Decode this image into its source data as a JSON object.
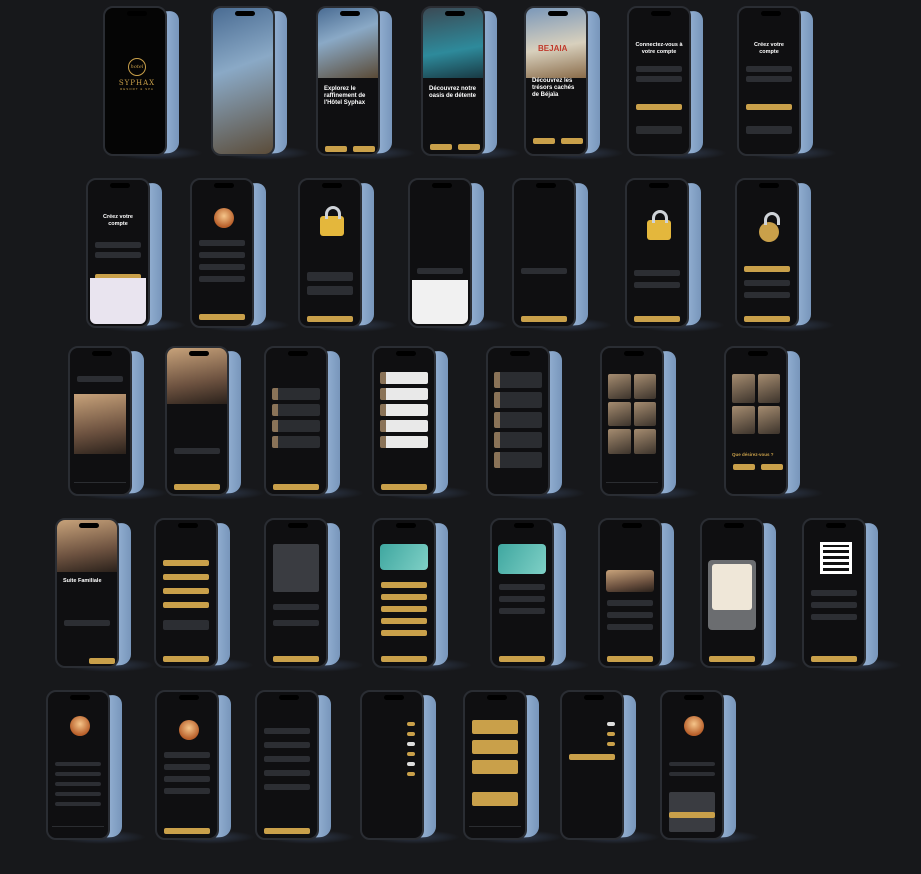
{
  "splash": {
    "logo_script": "hotel",
    "brand_name": "SYPHAX",
    "brand_tagline": "RESORT & SPA"
  },
  "onboarding": {
    "slide1_title": "Explorez le raffinement de l'Hôtel Syphax",
    "slide2_title": "Découvrez notre oasis de détente",
    "slide3_title": "Découvrez les trésors cachés de Béjaïa",
    "slide3_sign": "BEJAIA"
  },
  "auth": {
    "login_title": "Connectez-vous à votre compte",
    "signup_title": "Créez votre compte",
    "signup_title_2": "Créez votre compte"
  },
  "home": {
    "top_room_name": "Suite Familiale",
    "question": "Que désirez-vous ?"
  },
  "colors": {
    "background": "#17181b",
    "accent_gold": "#c9a04a",
    "phone_frame": "#9fbbdc",
    "screen_bg": "#0f0f11"
  }
}
